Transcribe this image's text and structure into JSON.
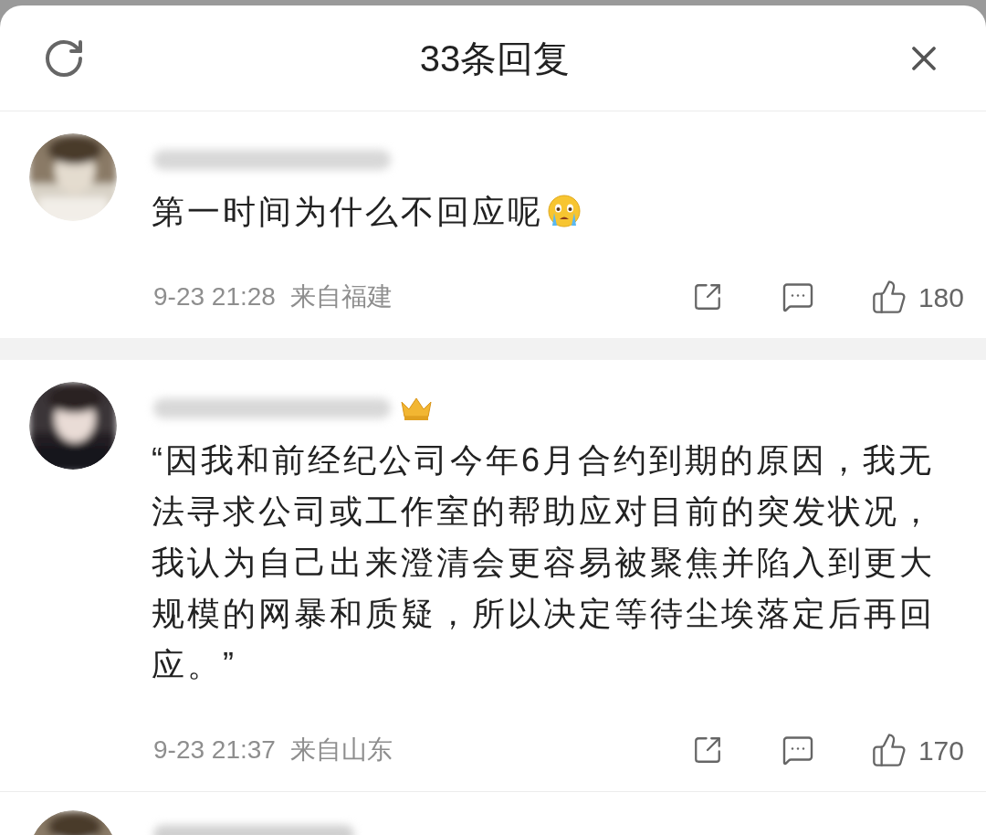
{
  "header": {
    "title": "33条回复"
  },
  "comments": [
    {
      "text": "第一时间为什么不回应呢",
      "reaction_emoji": true,
      "crown_badge": false,
      "time": "9-23 21:28",
      "location": "来自福建",
      "likes": "180"
    },
    {
      "text": "“因我和前经纪公司今年6月合约到期的原因，我无法寻求公司或工作室的帮助应对目前的突发状况，我认为自己出来澄清会更容易被聚焦并陷入到更大规模的网暴和质疑，所以决定等待尘埃落定后再回应。”",
      "reaction_emoji": false,
      "crown_badge": true,
      "time": "9-23 21:37",
      "location": "来自山东",
      "likes": "170"
    }
  ]
}
